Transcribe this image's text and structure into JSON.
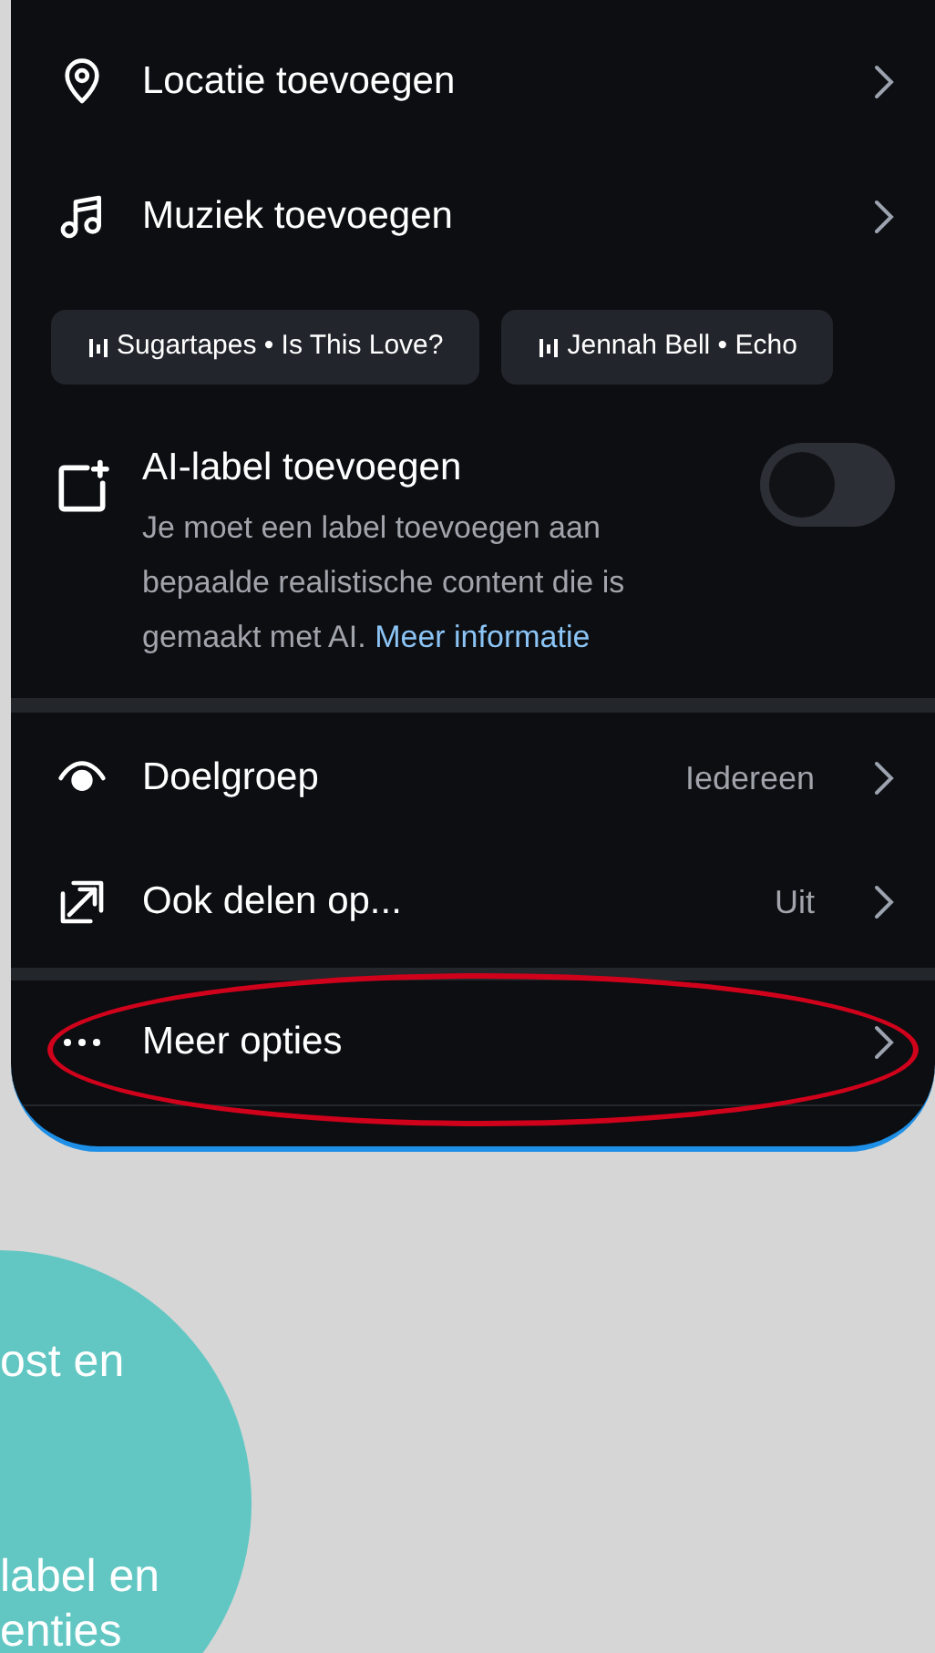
{
  "menu_top": [
    {
      "kind": "location",
      "label": "Locatie toevoegen"
    },
    {
      "kind": "music",
      "label": "Muziek toevoegen"
    }
  ],
  "music_chips": [
    {
      "label": "Sugartapes • Is This Love?"
    },
    {
      "label": "Jennah Bell • Echo"
    }
  ],
  "ai_label": {
    "title": "AI-label toevoegen",
    "description": "Je moet een label toevoegen aan bepaalde realistische content die is gemaakt met AI.",
    "link": "Meer informatie",
    "on": false
  },
  "menu_bottom": [
    {
      "kind": "audience",
      "label": "Doelgroep",
      "value": "Iedereen"
    },
    {
      "kind": "share",
      "label": "Ook delen op...",
      "value": "Uit"
    }
  ],
  "more": {
    "label": "Meer opties",
    "highlighted": true
  },
  "callout": {
    "lines": [
      "ost en",
      "label en",
      "enties"
    ]
  }
}
